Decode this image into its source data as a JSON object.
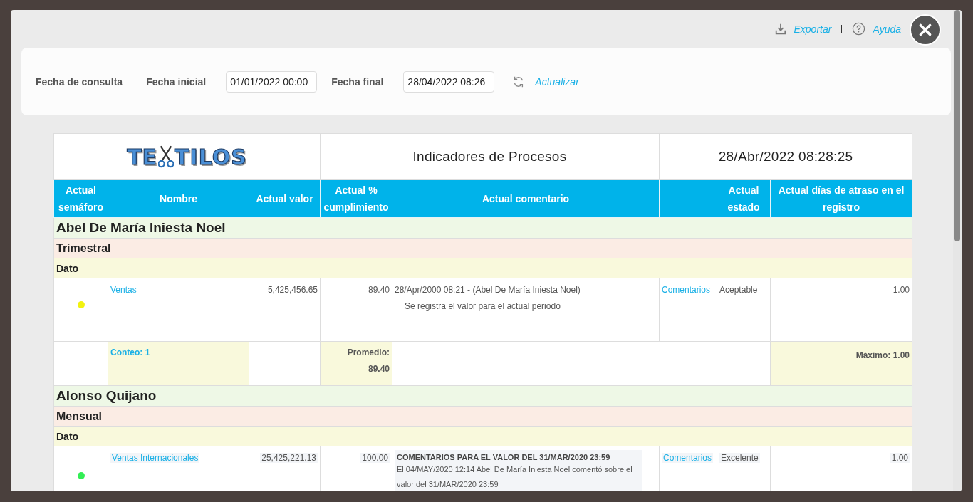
{
  "toolbar": {
    "export": "Exportar",
    "help": "Ayuda"
  },
  "filter": {
    "title": "Fecha de consulta",
    "start_label": "Fecha inicial",
    "start_value": "01/01/2022 00:00",
    "end_label": "Fecha final",
    "end_value": "28/04/2022 08:26",
    "refresh": "Actualizar"
  },
  "report": {
    "logo_left": "TE",
    "logo_right": "TILOS",
    "title": "Indicadores de Procesos",
    "date": "28/Abr/2022 08:28:25",
    "columns": [
      "Actual semáforo",
      "Nombre",
      "Actual valor",
      "Actual % cumplimiento",
      "Actual comentario",
      "",
      "Actual estado",
      "Actual días de atraso en el registro"
    ],
    "groups": [
      {
        "person": "Abel De María Iniesta Noel",
        "period": "Trimestral",
        "type": "Dato",
        "rows": [
          {
            "color": "#f2f20f",
            "name": "Ventas",
            "value": "5,425,456.65",
            "percent": "89.40",
            "comment": {
              "kind": "entry",
              "head": "28/Apr/2000 08:21 - (Abel De María Iniesta Noel)",
              "body": [
                "Se registra el valor para el actual periodo"
              ]
            },
            "link": "Comentarios",
            "state": "Aceptable",
            "days": "1.00",
            "highlighted": false
          }
        ],
        "summary": {
          "count": "Conteo: 1",
          "average_label": "Promedio:",
          "average": "89.40",
          "max": "Máximo: 1.00"
        }
      },
      {
        "person": "Alonso Quijano",
        "period": "Mensual",
        "type": "Dato",
        "rows": [
          {
            "color": "#33ee55",
            "name": "Ventas Internacionales",
            "value": "25,425,221.13",
            "percent": "100.00",
            "comment": {
              "kind": "titled",
              "head": "COMENTARIOS PARA EL VALOR DEL 31/MAR/2020 23:59",
              "body": [
                "El 04/MAY/2020 12:14 Abel De María Iniesta Noel comentó sobre el valor del 31/MAR/2020 23:59"
              ]
            },
            "link": "Comentarios",
            "state": "Excelente",
            "days": "1.00",
            "highlighted": true
          }
        ]
      }
    ]
  }
}
